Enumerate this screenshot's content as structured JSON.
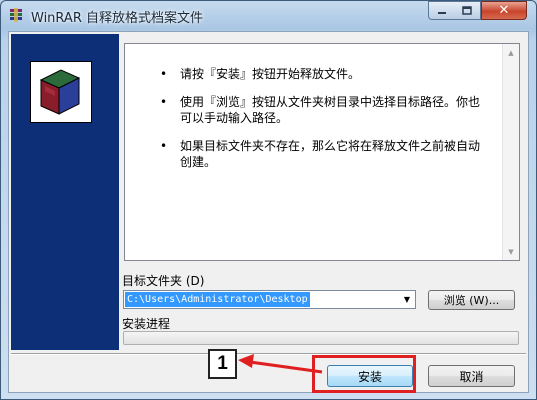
{
  "window": {
    "title": "WinRAR 自释放格式档案文件",
    "controls": {
      "close_glyph": "✕"
    }
  },
  "info": {
    "bullet_glyph": "•",
    "items": [
      "请按『安装』按钮开始释放文件。",
      "使用『浏览』按钮从文件夹树目录中选择目标路径。你也可以手动输入路径。",
      "如果目标文件夹不存在，那么它将在释放文件之前被自动创建。"
    ]
  },
  "destination": {
    "label": "目标文件夹 (D)",
    "value": "C:\\Users\\Administrator\\Desktop",
    "browse_label": "浏览 (W)..."
  },
  "progress": {
    "label": "安装进程",
    "value": 0
  },
  "buttons": {
    "install": "安装",
    "cancel": "取消"
  },
  "annotation": {
    "step_number": "1",
    "color": "#e02020"
  },
  "colors": {
    "sidebar": "#0d2f78",
    "selection": "#3399ff"
  }
}
